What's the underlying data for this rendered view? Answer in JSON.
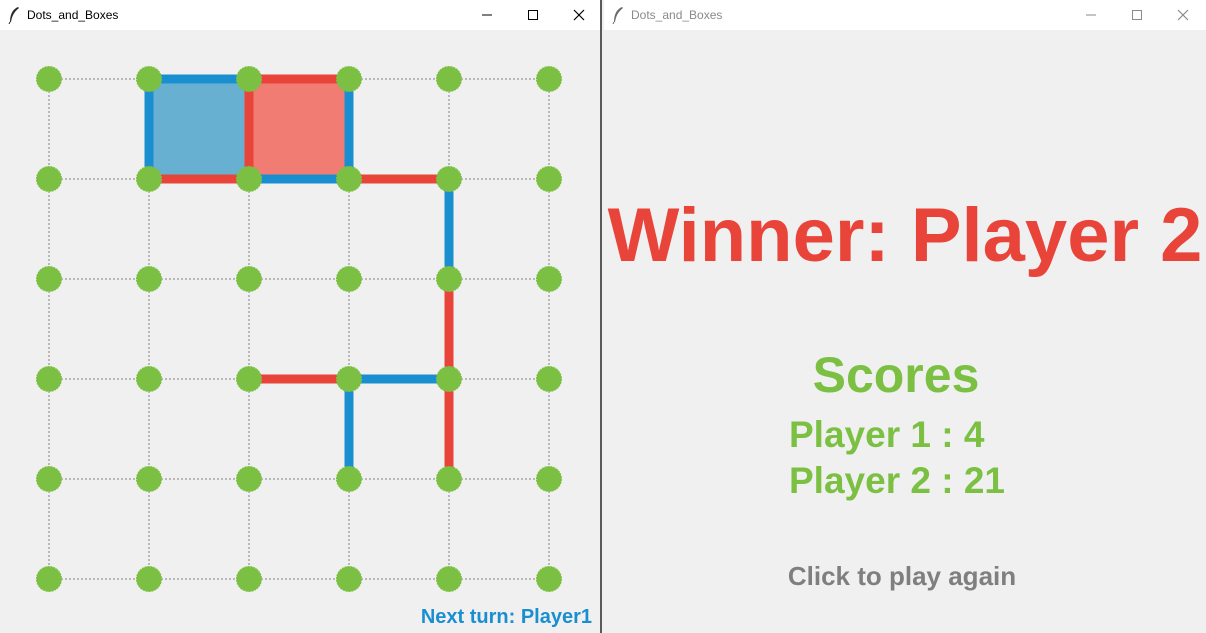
{
  "left_window": {
    "title": "Dots_and_Boxes",
    "next_turn": "Next turn: Player1",
    "colors": {
      "player1": "#1a8fd0",
      "player2": "#e8443a",
      "dot": "#7cc043",
      "box_p1": "#67b0d1",
      "box_p2": "#f07c74",
      "grid": "#808080"
    },
    "board": {
      "dots_per_side": 6,
      "p1_edges": [
        [
          1,
          0,
          2,
          0
        ],
        [
          1,
          0,
          1,
          1
        ],
        [
          2,
          1,
          3,
          1
        ],
        [
          3,
          0,
          3,
          1
        ],
        [
          4,
          1,
          4,
          2
        ],
        [
          3,
          3,
          4,
          3
        ],
        [
          3,
          3,
          3,
          4
        ]
      ],
      "p2_edges": [
        [
          2,
          0,
          3,
          0
        ],
        [
          1,
          1,
          2,
          1
        ],
        [
          2,
          0,
          2,
          1
        ],
        [
          3,
          1,
          4,
          1
        ],
        [
          4,
          2,
          4,
          3
        ],
        [
          2,
          3,
          3,
          3
        ],
        [
          4,
          3,
          4,
          4
        ]
      ],
      "p1_boxes": [
        [
          1,
          0
        ]
      ],
      "p2_boxes": [
        [
          2,
          0
        ]
      ]
    }
  },
  "right_window": {
    "title": "Dots_and_Boxes",
    "winner": "Winner: Player 2",
    "scores_title": "Scores",
    "player1_score": "Player 1 : 4",
    "player2_score": "Player 2 : 21",
    "play_again": "Click to play again"
  },
  "icons": [
    "feather-icon",
    "minimize-icon",
    "maximize-icon",
    "close-icon"
  ]
}
